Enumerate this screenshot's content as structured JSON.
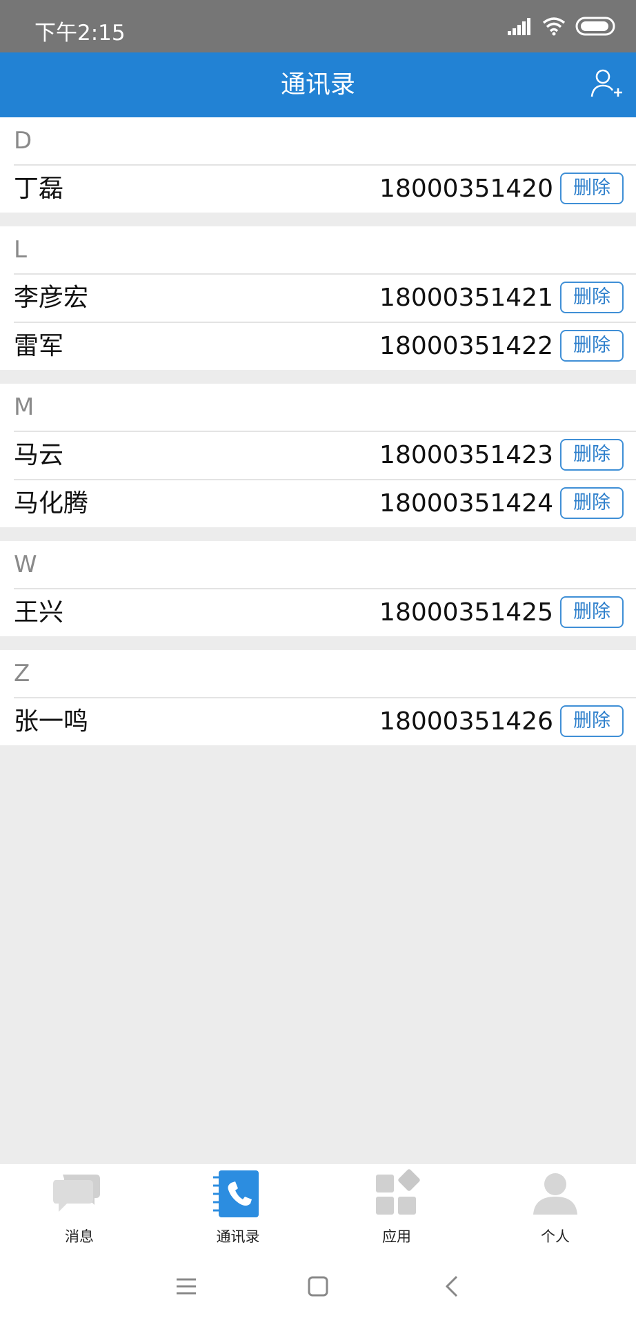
{
  "status_bar": {
    "time": "下午2:15"
  },
  "app_bar": {
    "title": "通讯录"
  },
  "delete_label": "删除",
  "sections": [
    {
      "letter": "D",
      "contacts": [
        {
          "name": "丁磊",
          "phone": "18000351420"
        }
      ]
    },
    {
      "letter": "L",
      "contacts": [
        {
          "name": "李彦宏",
          "phone": "18000351421"
        },
        {
          "name": "雷军",
          "phone": "18000351422"
        }
      ]
    },
    {
      "letter": "M",
      "contacts": [
        {
          "name": "马云",
          "phone": "18000351423"
        },
        {
          "name": "马化腾",
          "phone": "18000351424"
        }
      ]
    },
    {
      "letter": "W",
      "contacts": [
        {
          "name": "王兴",
          "phone": "18000351425"
        }
      ]
    },
    {
      "letter": "Z",
      "contacts": [
        {
          "name": "张一鸣",
          "phone": "18000351426"
        }
      ]
    }
  ],
  "tabs": [
    {
      "label": "消息",
      "icon": "chat-bubbles-icon",
      "active": false
    },
    {
      "label": "通讯录",
      "icon": "contacts-book-icon",
      "active": true
    },
    {
      "label": "应用",
      "icon": "apps-grid-icon",
      "active": false
    },
    {
      "label": "个人",
      "icon": "person-icon",
      "active": false
    }
  ],
  "colors": {
    "accent": "#2282d4",
    "status_bar": "#767676",
    "background": "#ececec",
    "inactive_icon": "#d3d3d3"
  }
}
